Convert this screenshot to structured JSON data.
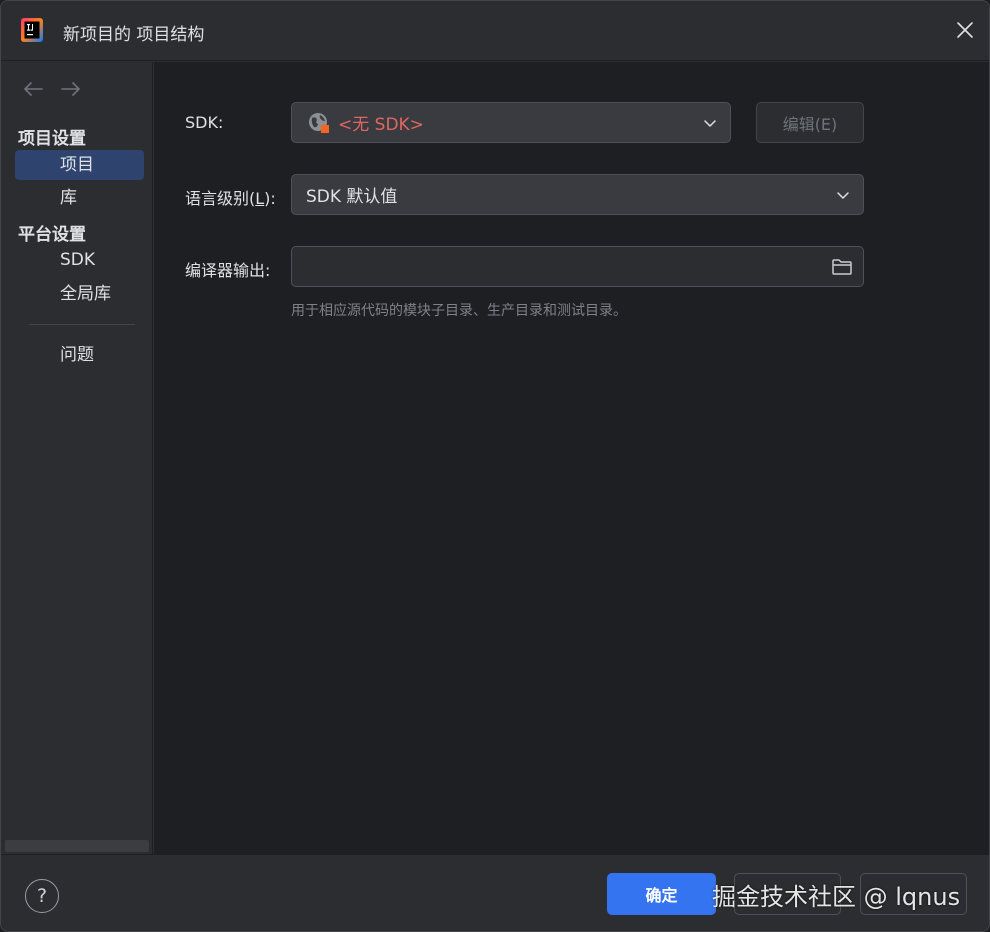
{
  "window": {
    "title": "新项目的 项目结构"
  },
  "sidebar": {
    "sections": [
      {
        "label": "项目设置"
      },
      {
        "label": "平台设置"
      }
    ],
    "items": [
      {
        "label": "项目",
        "selected": true
      },
      {
        "label": "库"
      },
      {
        "label": "SDK"
      },
      {
        "label": "全局库"
      },
      {
        "label": "问题"
      }
    ]
  },
  "form": {
    "sdk": {
      "label": "SDK:",
      "value": "<无 SDK>",
      "edit_button": "编辑(E)"
    },
    "language_level": {
      "label_prefix": "语言级别(",
      "label_mnemonic": "L",
      "label_suffix": "):",
      "value": "SDK 默认值"
    },
    "compiler_output": {
      "label": "编译器输出:",
      "value": "",
      "hint": "用于相应源代码的模块子目录、生产目录和测试目录。"
    }
  },
  "footer": {
    "help": "?",
    "ok": "确定"
  },
  "watermark": "掘金技术社区 @ lqnus",
  "colors": {
    "accent": "#3574f0",
    "selection": "#2e436e",
    "error_text": "#e0675f",
    "background": "#1e1f22",
    "panel": "#2b2d30"
  }
}
